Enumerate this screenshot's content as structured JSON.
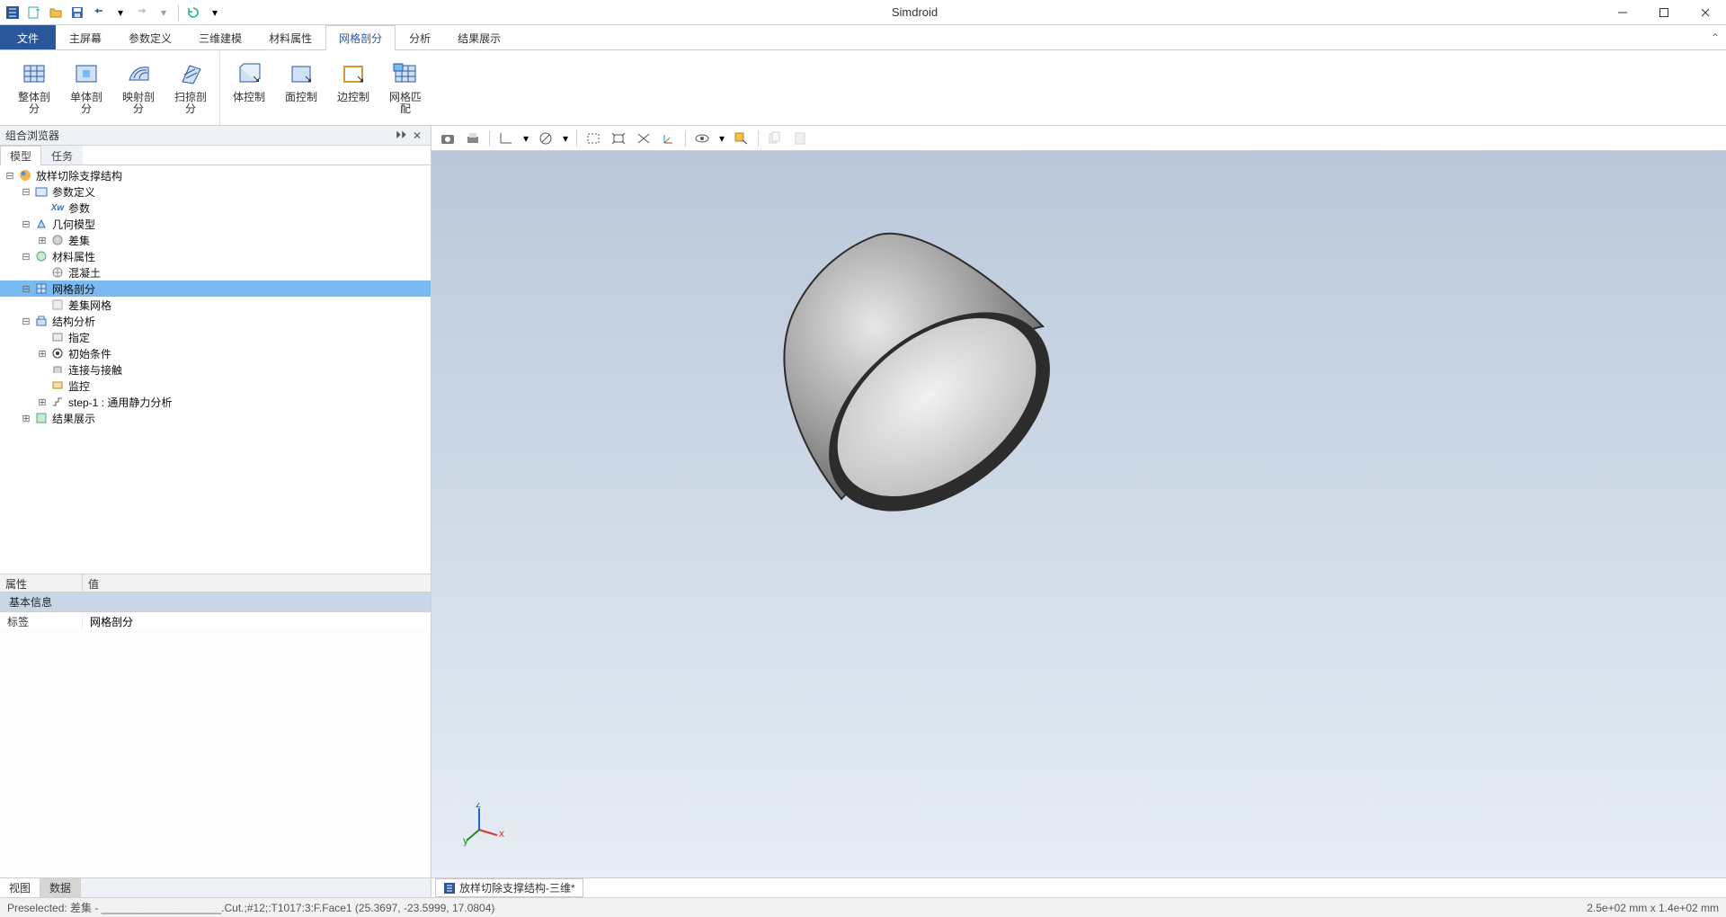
{
  "app": {
    "title": "Simdroid"
  },
  "ribbon_tabs": {
    "file": "文件",
    "items": [
      "主屏幕",
      "参数定义",
      "三维建模",
      "材料属性",
      "网格剖分",
      "分析",
      "结果展示"
    ],
    "active": "网格剖分"
  },
  "ribbon_buttons": {
    "g1": [
      "整体剖分",
      "单体剖分",
      "映射剖分",
      "扫掠剖分"
    ],
    "g2": [
      "体控制",
      "面控制",
      "边控制",
      "网格匹配"
    ]
  },
  "panel": {
    "title": "组合浏览器",
    "subtabs": {
      "a": "模型",
      "b": "任务"
    }
  },
  "tree": {
    "root": "放样切除支撑结构",
    "param_def": "参数定义",
    "param": "参数",
    "geom": "几何模型",
    "chaji": "差集",
    "mat": "材料属性",
    "concrete": "混凝土",
    "mesh": "网格剖分",
    "chaji_mesh": "差集网格",
    "struct": "结构分析",
    "assign": "指定",
    "ic": "初始条件",
    "contact": "连接与接触",
    "monitor": "监控",
    "step": "step-1 : 通用静力分析",
    "result": "结果展示"
  },
  "props": {
    "col_attr": "属性",
    "col_val": "值",
    "group": "基本信息",
    "label_k": "标签",
    "label_v": "网格剖分"
  },
  "bottom_tabs": {
    "a": "视图",
    "b": "数据"
  },
  "viewport_tab": "放样切除支撑结构-三维*",
  "status": {
    "left": "Preselected: 差集 - ____________________.Cut.;#12;:T1017:3:F.Face1 (25.3697, -23.5999, 17.0804)",
    "right": "2.5e+02 mm x 1.4e+02 mm"
  }
}
